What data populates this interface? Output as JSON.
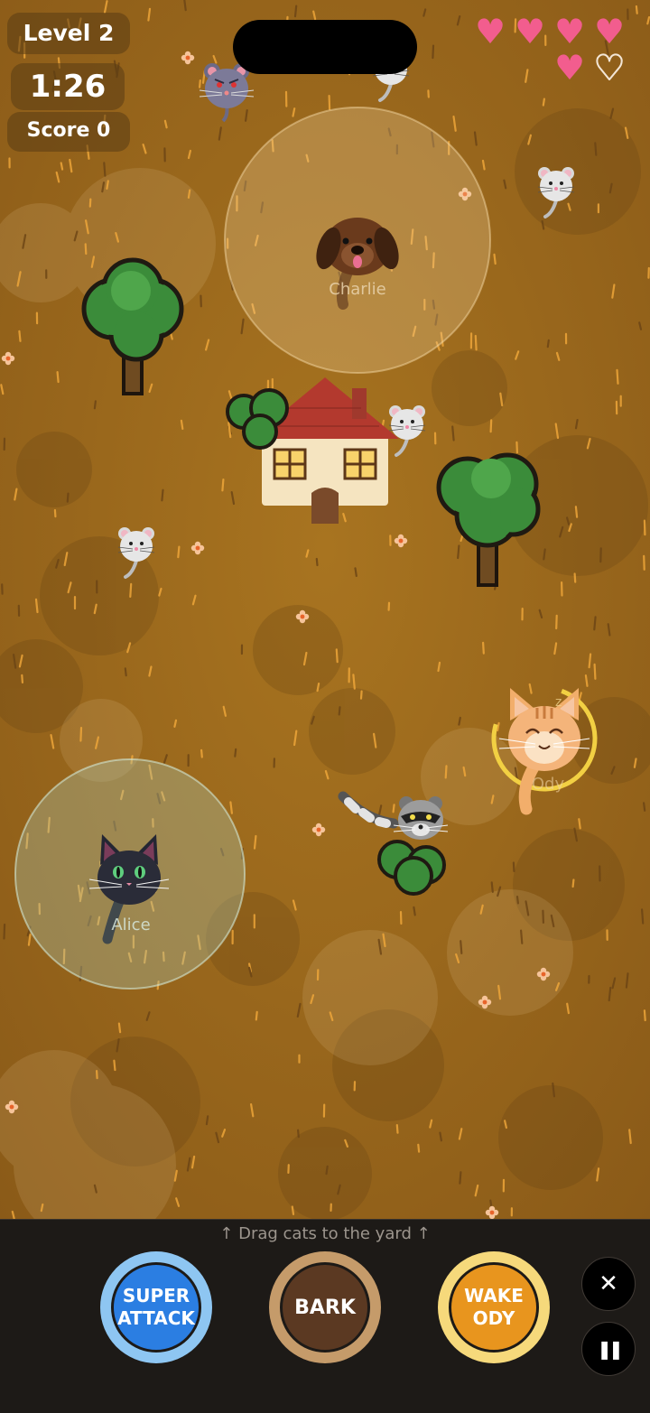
{
  "hud": {
    "level": "Level 2",
    "timer": "1:26",
    "score": "Score 0"
  },
  "lives": {
    "filled": 5,
    "total": 6
  },
  "characters": {
    "dog_name": "Charlie",
    "cat_black_name": "Alice",
    "cat_sleepy_name": "Ody"
  },
  "controls": {
    "hint": "↑ Drag cats to the yard ↑",
    "super_line1": "SUPER",
    "super_line2": "ATTACK",
    "bark_label": "BARK",
    "wake_line1": "WAKE",
    "wake_line2": "ODY",
    "close_glyph": "✕",
    "pause_glyph": "❚❚"
  },
  "colors": {
    "ground": "#a46f1e",
    "heart": "#f25d8e",
    "super": "#2b7ee2",
    "bark": "#5b3922",
    "wake": "#e8951e"
  }
}
